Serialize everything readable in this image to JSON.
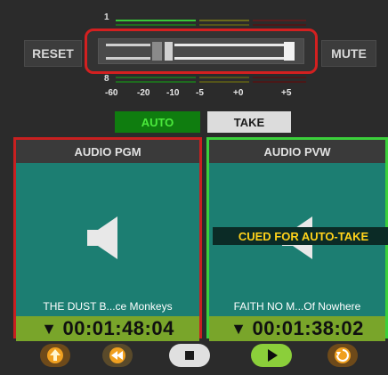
{
  "meters": {
    "top_label": "1",
    "bottom_label": "8"
  },
  "buttons": {
    "reset": "RESET",
    "mute": "MUTE"
  },
  "scale": [
    "-60",
    "-20",
    "-10",
    "-5",
    "+0",
    "+5"
  ],
  "modes": {
    "auto": "AUTO",
    "take": "TAKE"
  },
  "pgm": {
    "title": "AUDIO PGM",
    "track": "THE DUST B...ce Monkeys",
    "time": "00:01:48:04",
    "time_prefix": "▼"
  },
  "pvw": {
    "title": "AUDIO PVW",
    "track": "FAITH NO M...Of Nowhere",
    "time": "00:01:38:02",
    "time_prefix": "▼",
    "banner": "CUED FOR AUTO-TAKE"
  },
  "transport": [
    "upload-icon",
    "rewind-icon",
    "stop-icon",
    "play-icon",
    "replay-icon"
  ]
}
